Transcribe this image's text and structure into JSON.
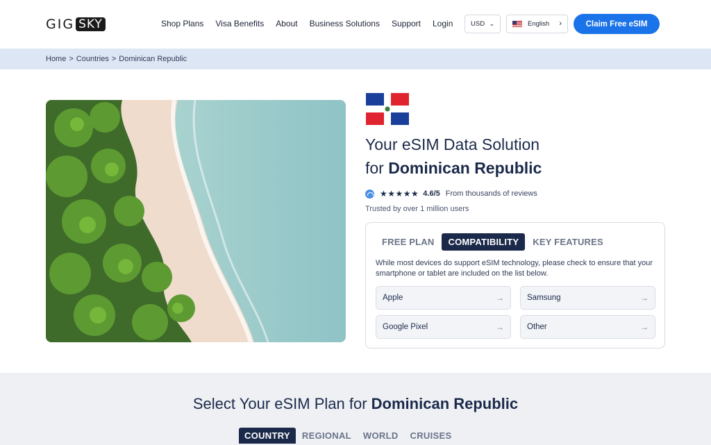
{
  "header": {
    "logo_part1": "GIG",
    "logo_part2": "SKY",
    "nav": [
      "Shop Plans",
      "Visa Benefits",
      "About",
      "Business Solutions",
      "Support",
      "Login"
    ],
    "currency": "USD",
    "language": "English",
    "cta": "Claim Free eSIM",
    "accent_color": "#1a73e8"
  },
  "breadcrumb": [
    "Home",
    ">",
    "Countries",
    ">",
    "Dominican Republic"
  ],
  "hero": {
    "title_line1": "Your eSIM Data Solution",
    "title_line2_prefix": "for ",
    "title_line2_country": "Dominican Republic",
    "stars": "★★★★★",
    "score": "4.6/5",
    "reviews": "From thousands of reviews",
    "trusted": "Trusted by over 1 million users"
  },
  "card": {
    "tabs": [
      "FREE PLAN",
      "COMPATIBILITY",
      "KEY FEATURES"
    ],
    "active_tab": "COMPATIBILITY",
    "description": "While most devices do support eSIM technology, please check to ensure that your smartphone or tablet are included on the list below.",
    "devices": [
      "Apple",
      "Samsung",
      "Google Pixel",
      "Other"
    ],
    "arrow": "→"
  },
  "plans": {
    "title_prefix": "Select Your eSIM Plan for ",
    "title_country": "Dominican Republic",
    "tabs": [
      "COUNTRY",
      "REGIONAL",
      "WORLD",
      "CRUISES"
    ],
    "active_tab": "COUNTRY"
  },
  "icons": {
    "currency_chevron": "chevron-down-icon",
    "lang_chevron": "chevron-right-icon",
    "device_arrow": "arrow-right-icon"
  }
}
